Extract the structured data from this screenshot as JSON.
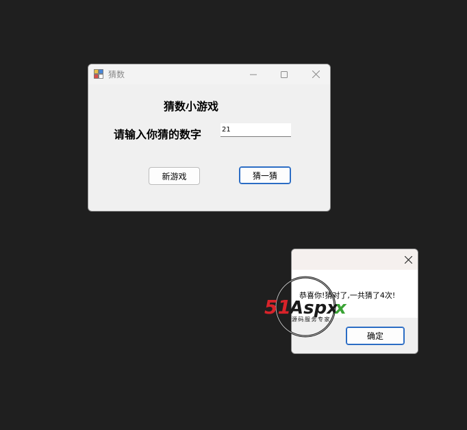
{
  "game_window": {
    "title": "猜数",
    "heading": "猜数小游戏",
    "prompt_label": "请输入你猜的数字",
    "guess_input": {
      "value": "21"
    },
    "buttons": {
      "new_game": "新游戏",
      "guess": "猜一猜"
    },
    "icons": {
      "app": "app-icon",
      "minimize": "minimize-icon",
      "maximize": "maximize-icon",
      "close": "close-icon"
    }
  },
  "message_box": {
    "message": "恭喜你!猜对了,一共猜了4次!",
    "ok_label": "确定",
    "icons": {
      "close": "close-icon"
    }
  },
  "watermark": {
    "brand": "51Aspx",
    "tagline": "源码服务专家"
  },
  "colors": {
    "desktop": "#1f1f1f",
    "window_bg": "#f0f0f0",
    "accent_focus": "#2a6cc4",
    "watermark_red": "#d8232a",
    "watermark_green": "#3aa335"
  }
}
